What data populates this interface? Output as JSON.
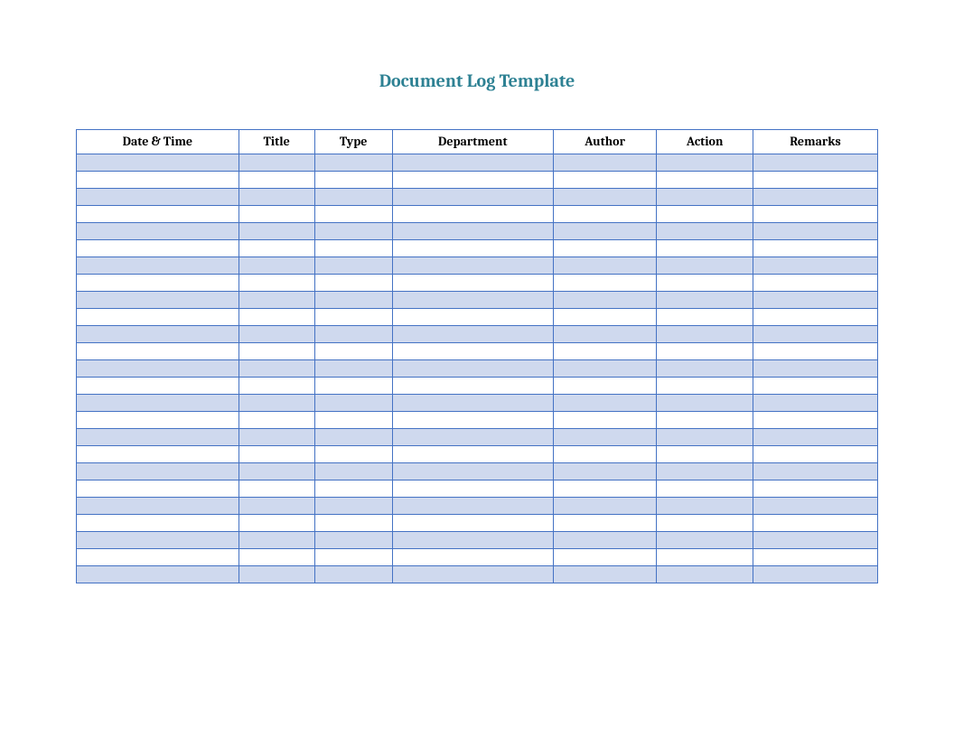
{
  "title": "Document Log Template",
  "columns": [
    "Date & Time",
    "Title",
    "Type",
    "Department",
    "Author",
    "Action",
    "Remarks"
  ],
  "row_count": 25,
  "colors": {
    "title": "#2d8193",
    "border": "#4472c4",
    "row_odd": "#cfd9ee",
    "row_even": "#ffffff"
  }
}
